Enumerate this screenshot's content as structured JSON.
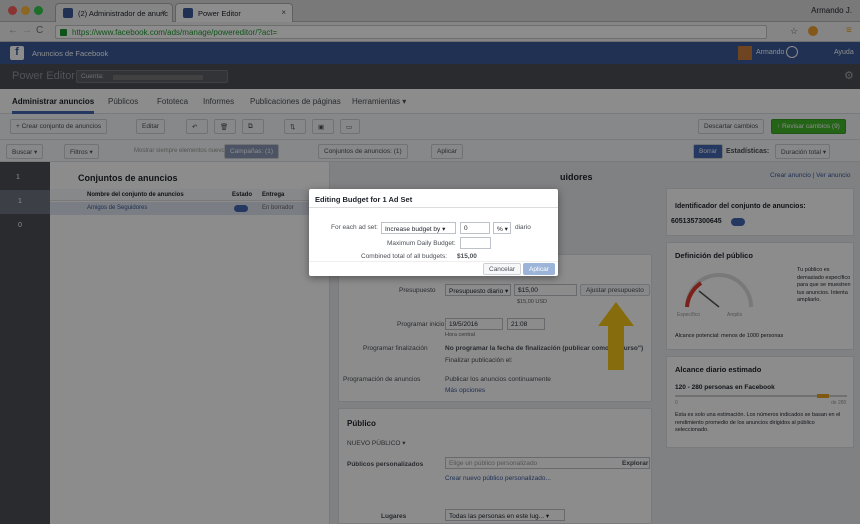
{
  "browser": {
    "tabs": [
      {
        "label": "(2) Administrador de anunc"
      },
      {
        "label": "Power Editor"
      }
    ],
    "url": "https://www.facebook.com/ads/manage/powereditor/?act=",
    "user": "Armando J."
  },
  "fb": {
    "title": "Anuncios de Facebook",
    "user": "Armando",
    "help": "Ayuda"
  },
  "pe": {
    "title": "Power Editor",
    "account_label": "Cuenta:"
  },
  "nav": {
    "items": [
      "Administrar anuncios",
      "Públicos",
      "Fototeca",
      "Informes",
      "Publicaciones de páginas",
      "Herramientas ▾"
    ]
  },
  "toolbar": {
    "create": "+ Crear conjunto de anuncios",
    "edit": "Editar",
    "discard": "Descartar cambios",
    "review": "↑ Revisar cambios (9)"
  },
  "filters": {
    "search": "Buscar ▾",
    "filters": "Filtros ▾",
    "show_always": "Mostrar siempre elementos nuevos",
    "campaigns": "Campañas: (1)",
    "adsets": "Conjuntos de anuncios: (1)",
    "apply": "Aplicar",
    "delete": "Borrar",
    "stats": "Estadísticas:",
    "stats_value": "Duración total ▾"
  },
  "leftnav": {
    "count1": "1",
    "count2": "1",
    "count3": "0"
  },
  "panel": {
    "title": "Conjuntos de anuncios",
    "cols": [
      "Nombre del conjunto de anuncios",
      "Estado",
      "Entrega"
    ],
    "row": {
      "name": "Amigos de Seguidores",
      "delivery": "En borrador"
    }
  },
  "detail": {
    "heading": "uidores",
    "create_ad": "Crear anuncio | Ver anuncio",
    "budget_label": "Presupuesto",
    "budget_type": "Presupuesto diario ▾",
    "budget_value": "$15,00",
    "budget_usd": "$15,00 USD",
    "adjust": "Ajustar presupuesto",
    "start_label": "Programar inicio",
    "start_date": "19/5/2016",
    "start_time": "21:08",
    "tz": "Hora central",
    "end_label": "Programar finalización",
    "end_opt1": "No programar la fecha de finalización (publicar como en curso\")",
    "end_opt2": "Finalizar publicación el:",
    "sched_label": "Programación de anuncios",
    "sched_value": "Publicar los anuncios continuamente",
    "more": "Más opciones",
    "public_title": "Público",
    "new_public": "NUEVO PÚBLICO ▾",
    "custom_label": "Públicos personalizados",
    "custom_ph": "Elige un público personalizado",
    "explore": "Explorar",
    "create_custom": "Crear nuevo público personalizado...",
    "places_label": "Lugares",
    "places_value": "Todas las personas en este lug... ▾"
  },
  "side": {
    "id_title": "Identificador del conjunto de anuncios:",
    "id_value": "6051357300645",
    "def_title": "Definición del público",
    "def_text": "Tu público es demasiado específico para que se muestren tus anuncios. Intenta ampliarlo.",
    "specific": "Específico",
    "broad": "Amplio",
    "reach": "Alcance potencial: menos de 1000 personas",
    "daily_title": "Alcance diario estimado",
    "daily_value": "120 - 280 personas en Facebook",
    "daily_max": "de 280",
    "daily_min": "0",
    "daily_text": "Esta es solo una estimación. Los números indicados se basan en el rendimiento promedio de los anuncios dirigidos al público seleccionado."
  },
  "modal": {
    "title": "Editing Budget for 1 Ad Set",
    "for_each": "For each ad set:",
    "action": "Increase budget by ▾",
    "amount": "0",
    "unit": "% ▾",
    "period": "diario",
    "max_label": "Maximum Daily Budget:",
    "total_label": "Combined total of all budgets:",
    "total_value": "$15,00",
    "cancel": "Cancelar",
    "apply": "Aplicar"
  },
  "colors": {
    "fb_blue": "#3b5998",
    "green": "#42b72a",
    "arrow": "#f5c518"
  }
}
